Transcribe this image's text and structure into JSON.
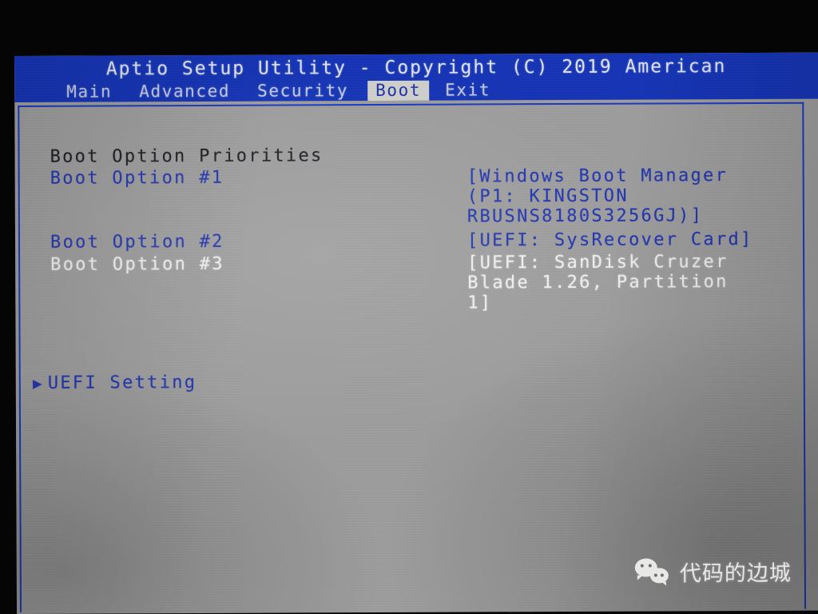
{
  "header": {
    "title": "Aptio Setup Utility - Copyright (C) 2019 American",
    "tabs": [
      {
        "label": "Main",
        "selected": false
      },
      {
        "label": "Advanced",
        "selected": false
      },
      {
        "label": "Security",
        "selected": false
      },
      {
        "label": "Boot",
        "selected": true
      },
      {
        "label": "Exit",
        "selected": false
      }
    ]
  },
  "main": {
    "section_title": "Boot Option Priorities",
    "options": [
      {
        "label": "Boot Option #1",
        "value_lines": [
          "[Windows Boot Manager",
          "(P1: KINGSTON",
          "RBUSNS8180S3256GJ)]"
        ],
        "highlighted": false
      },
      {
        "label": "Boot Option #2",
        "value_lines": [
          "[UEFI: SysRecover Card]"
        ],
        "highlighted": false
      },
      {
        "label": "Boot Option #3",
        "value_lines": [
          "[UEFI: SanDisk Cruzer",
          "Blade 1.26, Partition",
          "1]"
        ],
        "highlighted": true
      }
    ],
    "submenu": {
      "arrow": "▶",
      "label": "UEFI Setting"
    }
  },
  "watermark": {
    "icon": "wechat-icon",
    "text": "代码的边城"
  },
  "colors": {
    "titlebar_blue": "#1433b5",
    "panel_gray": "#9d9d9d",
    "text_blue": "#2235ad",
    "text_white": "#f0f0ee",
    "text_dark": "#1d1f26",
    "border_blue": "#1a38c0"
  }
}
